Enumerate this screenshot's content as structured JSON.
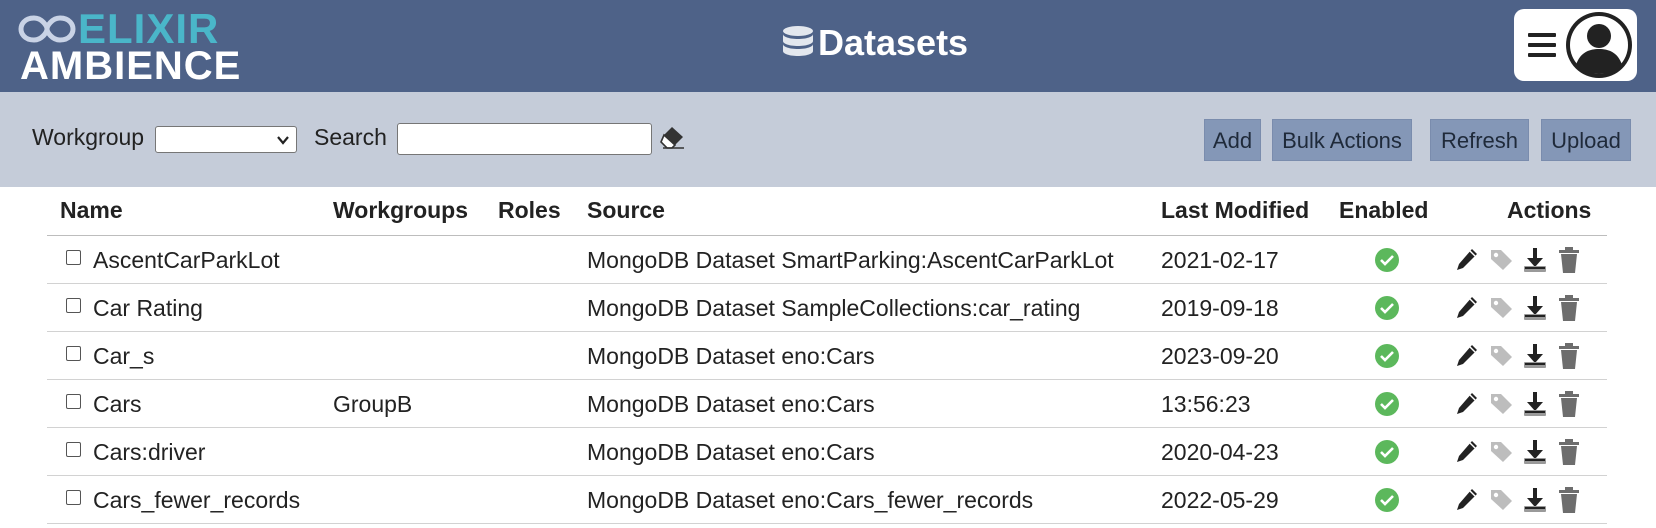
{
  "header": {
    "logo": {
      "line1": "ELIXIR",
      "line2": "AMBIENCE"
    },
    "title": "Datasets",
    "title_icon": "database-icon",
    "menu_icon": "hamburger-icon",
    "avatar_icon": "user-avatar-icon"
  },
  "toolbar": {
    "workgroup_label": "Workgroup",
    "workgroup_value": "",
    "search_label": "Search",
    "search_value": "",
    "clear_icon": "eraser-icon",
    "buttons": {
      "add": "Add",
      "bulk": "Bulk Actions",
      "refresh": "Refresh",
      "upload": "Upload"
    }
  },
  "table": {
    "columns": {
      "name": "Name",
      "workgroups": "Workgroups",
      "roles": "Roles",
      "source": "Source",
      "last_modified": "Last Modified",
      "enabled": "Enabled",
      "actions": "Actions"
    },
    "rows": [
      {
        "name": "AscentCarParkLot",
        "workgroups": "",
        "roles": "",
        "source": "MongoDB Dataset SmartParking:AscentCarParkLot",
        "last_modified": "2021-02-17",
        "enabled": true
      },
      {
        "name": "Car Rating",
        "workgroups": "",
        "roles": "",
        "source": "MongoDB Dataset SampleCollections:car_rating",
        "last_modified": "2019-09-18",
        "enabled": true
      },
      {
        "name": "Car_s",
        "workgroups": "",
        "roles": "",
        "source": "MongoDB Dataset eno:Cars",
        "last_modified": "2023-09-20",
        "enabled": true
      },
      {
        "name": "Cars",
        "workgroups": "GroupB",
        "roles": "",
        "source": "MongoDB Dataset eno:Cars",
        "last_modified": "13:56:23",
        "enabled": true
      },
      {
        "name": "Cars:driver",
        "workgroups": "",
        "roles": "",
        "source": "MongoDB Dataset eno:Cars",
        "last_modified": "2020-04-23",
        "enabled": true
      },
      {
        "name": "Cars_fewer_records",
        "workgroups": "",
        "roles": "",
        "source": "MongoDB Dataset eno:Cars_fewer_records",
        "last_modified": "2022-05-29",
        "enabled": true
      }
    ],
    "action_icons": [
      "pencil-icon",
      "tag-icon",
      "download-icon",
      "trash-icon"
    ]
  },
  "colors": {
    "header_bg": "#4e6288",
    "toolbar_bg": "#c5ccd9",
    "logo_accent": "#4ab6c9",
    "button_bg": "#8497b7",
    "enabled_green": "#5cb85c"
  }
}
